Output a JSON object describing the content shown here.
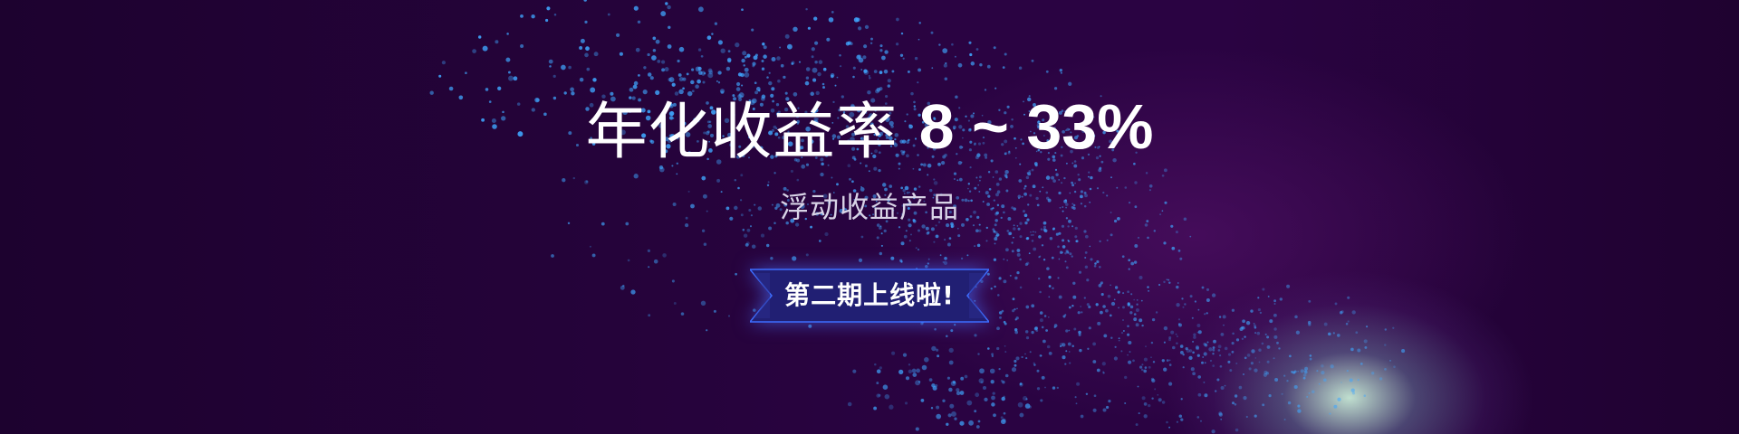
{
  "banner": {
    "title_prefix": "年化收益率",
    "title_range": "8 ~ 33%",
    "subtitle": "浮动收益产品",
    "cta_label": "第二期上线啦!",
    "colors": {
      "background": "#1f0330",
      "particles": "#3fa7ff",
      "ribbon": "#211f73",
      "ribbon_glow": "#466eff",
      "glow": "#c8ebd7"
    }
  }
}
